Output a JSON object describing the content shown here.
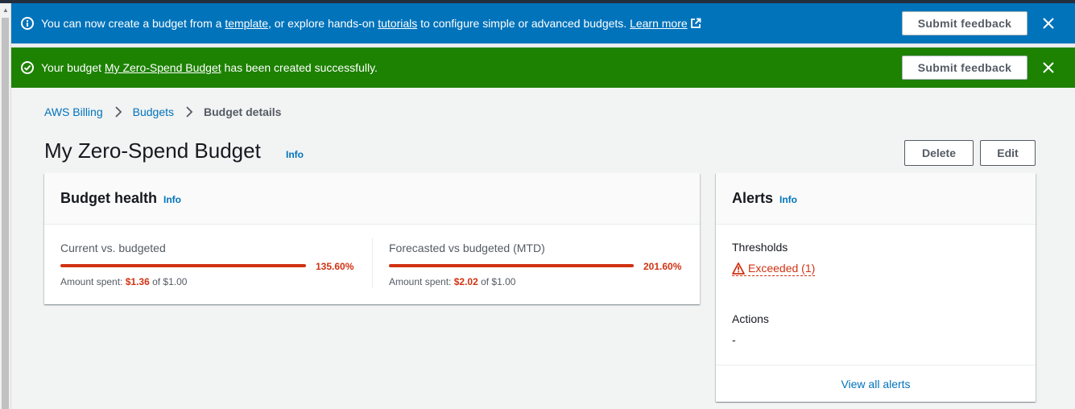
{
  "info_flash": {
    "text_1": "You can now create a budget from a ",
    "link_template": "template",
    "text_2": ", or explore hands-on ",
    "link_tutorials": "tutorials",
    "text_3": " to configure simple or advanced budgets. ",
    "link_learn_more": "Learn more",
    "feedback_label": "Submit feedback",
    "color": "#0073bb"
  },
  "success_flash": {
    "text_1": "Your budget ",
    "link_budget": "My Zero-Spend Budget",
    "text_2": " has been created successfully.",
    "feedback_label": "Submit feedback",
    "color": "#1d8102"
  },
  "breadcrumb": {
    "items": [
      "AWS Billing",
      "Budgets",
      "Budget details"
    ]
  },
  "header": {
    "title": "My Zero-Spend Budget",
    "info": "Info",
    "delete_label": "Delete",
    "edit_label": "Edit"
  },
  "budget_health": {
    "title": "Budget health",
    "info": "Info",
    "current": {
      "label": "Current vs. budgeted",
      "percent": "135.60%",
      "progress": 1.0,
      "amount_prefix": "Amount spent: ",
      "spent": "$1.36",
      "amount_suffix": " of $1.00"
    },
    "forecast": {
      "label": "Forecasted vs budgeted (MTD)",
      "percent": "201.60%",
      "progress": 1.0,
      "amount_prefix": "Amount spent: ",
      "spent": "$2.02",
      "amount_suffix": " of $1.00"
    },
    "status_color": "#d13212"
  },
  "alerts": {
    "title": "Alerts",
    "info": "Info",
    "thresholds_label": "Thresholds",
    "thresholds_value": "Exceeded (1)",
    "actions_label": "Actions",
    "actions_value": "-",
    "view_all": "View all alerts"
  }
}
